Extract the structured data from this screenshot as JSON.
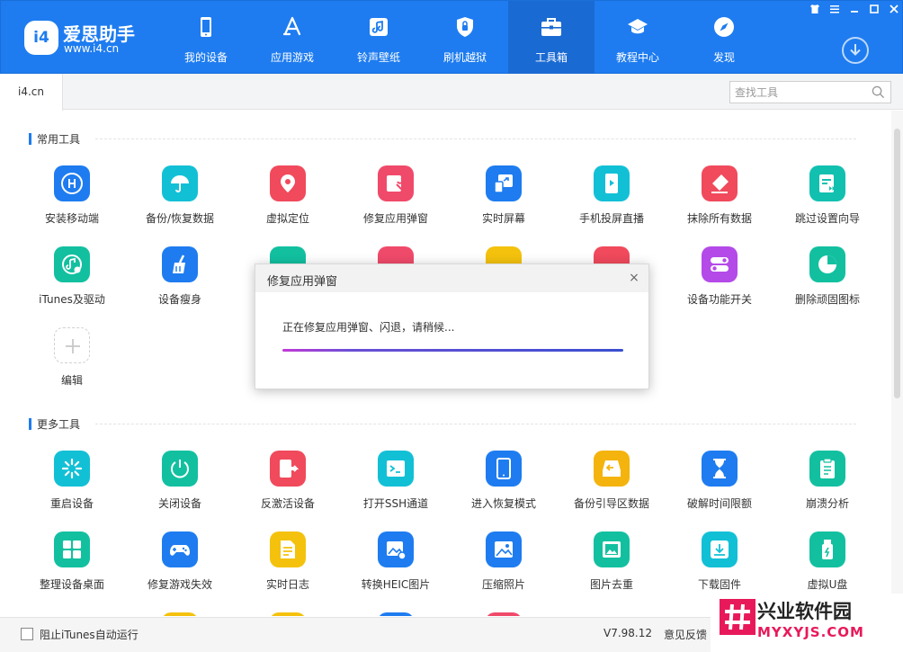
{
  "app": {
    "name": "爱思助手",
    "url": "www.i4.cn",
    "logo_text": "i4"
  },
  "nav": [
    {
      "label": "我的设备",
      "icon": "phone-icon",
      "active": false
    },
    {
      "label": "应用游戏",
      "icon": "app-store-icon",
      "active": false
    },
    {
      "label": "铃声壁纸",
      "icon": "music-note-icon",
      "active": false
    },
    {
      "label": "刷机越狱",
      "icon": "shield-icon",
      "active": false
    },
    {
      "label": "工具箱",
      "icon": "toolbox-icon",
      "active": true
    },
    {
      "label": "教程中心",
      "icon": "graduation-cap-icon",
      "active": false
    },
    {
      "label": "发现",
      "icon": "compass-icon",
      "active": false
    }
  ],
  "window_controls": [
    "shirt-icon",
    "list-icon",
    "minimize-icon",
    "maximize-icon",
    "close-icon"
  ],
  "tabbar": {
    "tab_label": "i4.cn",
    "search_placeholder": "查找工具"
  },
  "sections": {
    "common": "常用工具",
    "more": "更多工具"
  },
  "common_tools": [
    {
      "label": "安装移动端",
      "icon": "i4-app-icon",
      "color": "#1e7cf0"
    },
    {
      "label": "备份/恢复数据",
      "icon": "umbrella-icon",
      "color": "#12c0d6"
    },
    {
      "label": "虚拟定位",
      "icon": "location-pin-icon",
      "color": "#f04a5c"
    },
    {
      "label": "修复应用弹窗",
      "icon": "wrench-icon",
      "color": "#f04a6a"
    },
    {
      "label": "实时屏幕",
      "icon": "screen-mirror-icon",
      "color": "#1e7cf0"
    },
    {
      "label": "手机投屏直播",
      "icon": "phone-play-icon",
      "color": "#12c0d6"
    },
    {
      "label": "抹除所有数据",
      "icon": "eraser-icon",
      "color": "#f04a5c"
    },
    {
      "label": "跳过设置向导",
      "icon": "skip-wizard-icon",
      "color": "#12c0b0"
    },
    {
      "label": "iTunes及驱动",
      "icon": "itunes-icon",
      "color": "#12c0a0"
    },
    {
      "label": "设备瘦身",
      "icon": "broom-icon",
      "color": "#1e7cf0"
    },
    {
      "label": "",
      "icon": "ipcc-icon",
      "color": "#12c0a0"
    },
    {
      "label": "",
      "icon": "signal-icon",
      "color": "#f04a6a"
    },
    {
      "label": "",
      "icon": "settings-icon",
      "color": "#f4c20d"
    },
    {
      "label": "",
      "icon": "ringtone-icon",
      "color": "#f04a5c"
    },
    {
      "label": "设备功能开关",
      "icon": "toggle-icon",
      "color": "#b44ae8"
    },
    {
      "label": "删除顽固图标",
      "icon": "pie-icon",
      "color": "#12c0a0"
    },
    {
      "label": "编辑",
      "icon": "plus-icon",
      "color": ""
    }
  ],
  "more_tools": [
    {
      "label": "重启设备",
      "icon": "restart-icon",
      "color": "#12c0d6"
    },
    {
      "label": "关闭设备",
      "icon": "power-icon",
      "color": "#12c0a0"
    },
    {
      "label": "反激活设备",
      "icon": "deactivate-icon",
      "color": "#f04a5c"
    },
    {
      "label": "打开SSH通道",
      "icon": "terminal-icon",
      "color": "#12c0d6"
    },
    {
      "label": "进入恢复模式",
      "icon": "tablet-icon",
      "color": "#1e7cf0"
    },
    {
      "label": "备份引导区数据",
      "icon": "drive-backup-icon",
      "color": "#f4b40d"
    },
    {
      "label": "破解时间限额",
      "icon": "hourglass-icon",
      "color": "#1e7cf0"
    },
    {
      "label": "崩溃分析",
      "icon": "clipboard-icon",
      "color": "#12c0a0"
    },
    {
      "label": "整理设备桌面",
      "icon": "grid-icon",
      "color": "#12c0a0"
    },
    {
      "label": "修复游戏失效",
      "icon": "gamepad-icon",
      "color": "#1e7cf0"
    },
    {
      "label": "实时日志",
      "icon": "document-icon",
      "color": "#f4c20d"
    },
    {
      "label": "转换HEIC图片",
      "icon": "image-convert-icon",
      "color": "#1e7cf0"
    },
    {
      "label": "压缩照片",
      "icon": "image-icon",
      "color": "#1e7cf0"
    },
    {
      "label": "图片去重",
      "icon": "image-dedupe-icon",
      "color": "#12c0a0"
    },
    {
      "label": "下载固件",
      "icon": "download-box-icon",
      "color": "#12c0d6"
    },
    {
      "label": "虚拟U盘",
      "icon": "usb-drive-icon",
      "color": "#12c0a0"
    }
  ],
  "dialog": {
    "title": "修复应用弹窗",
    "message": "正在修复应用弹窗、闪退，请稍候...",
    "progress": 1.0
  },
  "footer": {
    "checkbox_label": "阻止iTunes自动运行",
    "version": "V7.98.12",
    "feedback": "意见反馈"
  },
  "watermark": {
    "title": "兴业软件园",
    "url": "MYXYJS.COM"
  }
}
